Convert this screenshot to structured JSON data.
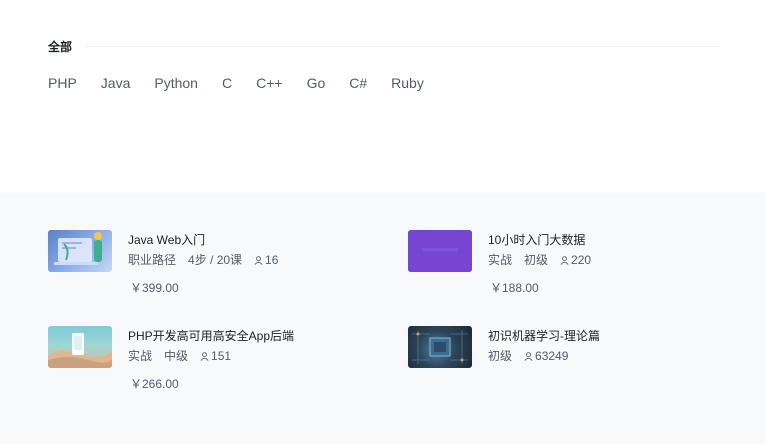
{
  "category": {
    "title": "全部"
  },
  "languages": [
    "PHP",
    "Java",
    "Python",
    "C",
    "C++",
    "Go",
    "C#",
    "Ruby"
  ],
  "courses": [
    {
      "title": "Java Web入门",
      "tags": [
        "职业路径",
        "4步 / 20课"
      ],
      "students": "16",
      "price": "￥399.00",
      "thumb": "laptop-code-illustration"
    },
    {
      "title": "10小时入门大数据",
      "tags": [
        "实战",
        "初级"
      ],
      "students": "220",
      "price": "￥188.00",
      "thumb": "purple-banner"
    },
    {
      "title": "PHP开发高可用高安全App后端",
      "tags": [
        "实战",
        "中级"
      ],
      "students": "151",
      "price": "￥266.00",
      "thumb": "landscape-phone-illustration"
    },
    {
      "title": "初识机器学习-理论篇",
      "tags": [
        "初级"
      ],
      "students": "63249",
      "price": "",
      "thumb": "circuit-chip-image"
    }
  ],
  "icons": {
    "students": "person-icon"
  },
  "colors": {
    "text": "#1c1f21",
    "muted": "#545c63",
    "section_bg": "#f8f9fb"
  }
}
